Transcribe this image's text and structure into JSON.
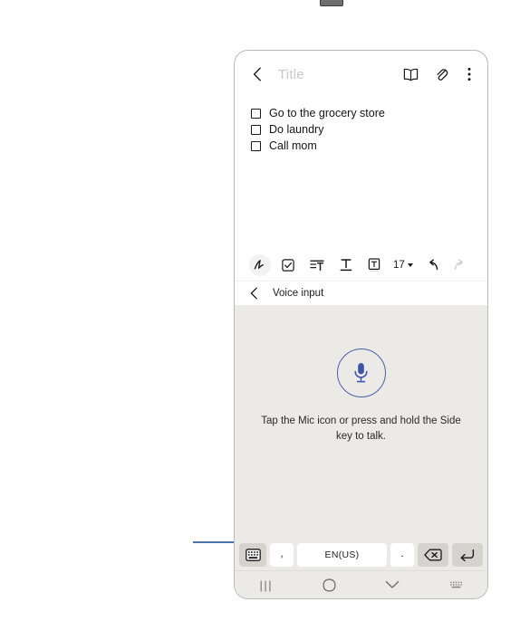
{
  "device": {
    "note_header": {
      "back_icon": "chevron-left-icon",
      "title_placeholder": "Title",
      "reading_mode_icon": "book-icon",
      "attach_icon": "paperclip-icon",
      "more_icon": "three-dot-menu-icon"
    },
    "note_body": {
      "todos": [
        {
          "label": "Go to the grocery store",
          "checked": false
        },
        {
          "label": "Do laundry",
          "checked": false
        },
        {
          "label": "Call mom",
          "checked": false
        }
      ]
    },
    "format_toolbar": {
      "items": [
        {
          "name": "pen-icon",
          "label": ""
        },
        {
          "name": "checklist-icon",
          "label": ""
        },
        {
          "name": "list-format-icon",
          "label": ""
        },
        {
          "name": "text-style-icon",
          "label": ""
        },
        {
          "name": "text-box-icon",
          "label": ""
        }
      ],
      "font_size": "17",
      "undo_icon": "undo-arrow-icon",
      "redo_icon": "redo-arrow-icon"
    },
    "voice_input_bar": {
      "back_icon": "chevron-left-icon",
      "label": "Voice input"
    },
    "voice_panel": {
      "mic_icon": "microphone-icon",
      "hint": "Tap the Mic icon or press and hold the Side key to talk.",
      "accent_color": "#4a5fa8"
    },
    "keyboard_row": {
      "switch_key_icon": "keyboard-icon",
      "comma_key": ",",
      "language_key": "EN(US)",
      "period_key": ".",
      "backspace_icon": "backspace-icon",
      "enter_icon": "enter-return-icon"
    },
    "nav_bar": {
      "recents_label": "|||",
      "home_icon": "home-circle-icon",
      "hide_keyboard_icon": "chevron-down-icon",
      "keyboard_icon": "keyboard-grid-icon"
    }
  },
  "annotation": {
    "callout_color": "#4a74a8",
    "target": "keyboard-switch-key"
  }
}
